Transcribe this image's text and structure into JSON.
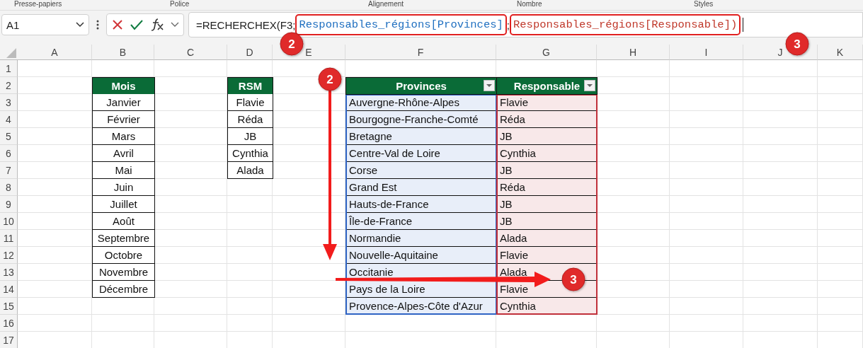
{
  "ribbon_groups": [
    "Presse-papiers",
    "Police",
    "Alignement",
    "Nombre",
    "Styles"
  ],
  "name_box": {
    "value": "A1"
  },
  "formula_bar": {
    "parts": [
      {
        "text": "=RECHERCHEX(F3",
        "kind": "plain"
      },
      {
        "text": ";",
        "kind": "plain"
      },
      {
        "text": "Responsables_régions[Provinces]",
        "kind": "reference",
        "color": "#1f6fc0"
      },
      {
        "text": ";",
        "kind": "plain"
      },
      {
        "text": "Responsables_régions[Responsable])",
        "kind": "reference",
        "color": "#c0392b"
      }
    ]
  },
  "columns": [
    "A",
    "B",
    "C",
    "D",
    "E",
    "F",
    "G",
    "H",
    "I",
    "J",
    "K"
  ],
  "rows": [
    "1",
    "2",
    "3",
    "4",
    "5",
    "6",
    "7",
    "8",
    "9",
    "10",
    "11",
    "12",
    "13",
    "14",
    "15",
    "16",
    "17"
  ],
  "mois_table": {
    "header": "Mois",
    "items": [
      "Janvier",
      "Février",
      "Mars",
      "Avril",
      "Mai",
      "Juin",
      "Juillet",
      "Août",
      "Septembre",
      "Octobre",
      "Novembre",
      "Décembre"
    ]
  },
  "rsm_table": {
    "header": "RSM",
    "items": [
      "Flavie",
      "Réda",
      "JB",
      "Cynthia",
      "Alada"
    ]
  },
  "regions_table": {
    "columns": [
      {
        "header": "Provinces",
        "color": "#2f64c4"
      },
      {
        "header": "Responsable",
        "color": "#c0303a"
      }
    ],
    "rows": [
      [
        "Auvergne-Rhône-Alpes",
        "Flavie"
      ],
      [
        "Bourgogne-Franche-Comté",
        "Réda"
      ],
      [
        "Bretagne",
        "JB"
      ],
      [
        "Centre-Val de Loire",
        "Cynthia"
      ],
      [
        "Corse",
        "JB"
      ],
      [
        "Grand Est",
        "Réda"
      ],
      [
        "Hauts-de-France",
        "JB"
      ],
      [
        "Île-de-France",
        "JB"
      ],
      [
        "Normandie",
        "Alada"
      ],
      [
        "Nouvelle-Aquitaine",
        "Flavie"
      ],
      [
        "Occitanie",
        "Alada"
      ],
      [
        "Pays de la Loire",
        "Flavie"
      ],
      [
        "Provence-Alpes-Côte d'Azur",
        "Cynthia"
      ]
    ]
  },
  "callouts": [
    {
      "label": "2"
    },
    {
      "label": "3"
    },
    {
      "label": "2"
    },
    {
      "label": "3"
    }
  ]
}
